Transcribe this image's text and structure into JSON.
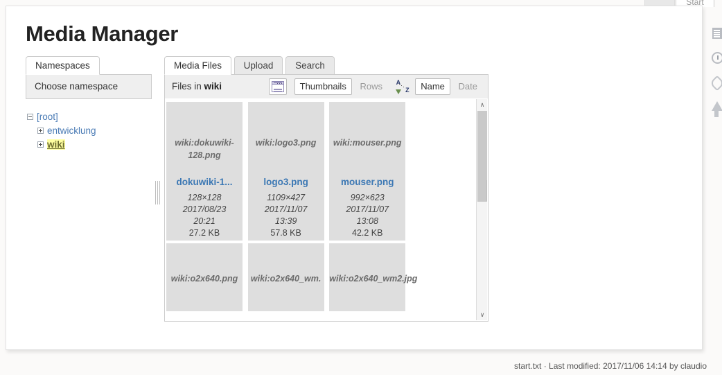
{
  "browser": {
    "start_tab_label": "Start"
  },
  "page": {
    "title": "Media Manager"
  },
  "namespace_panel": {
    "tabs": [
      {
        "label": "Namespaces",
        "active": true
      }
    ],
    "header": "Choose namespace",
    "tree": [
      {
        "label": "[root]",
        "toggle": "minus",
        "level": 1,
        "highlighted": false
      },
      {
        "label": "entwicklung",
        "toggle": "plus",
        "level": 2,
        "highlighted": false
      },
      {
        "label": "wiki",
        "toggle": "plus",
        "level": 2,
        "highlighted": true
      }
    ]
  },
  "files_panel": {
    "tabs": [
      {
        "label": "Media Files",
        "active": true
      },
      {
        "label": "Upload",
        "active": false
      },
      {
        "label": "Search",
        "active": false
      }
    ],
    "header_prefix": "Files in",
    "header_namespace": "wiki",
    "toolbar": {
      "view_icon": "window-list-icon",
      "view_options": [
        {
          "label": "Thumbnails",
          "active": true
        },
        {
          "label": "Rows",
          "active": false
        }
      ],
      "sort_icon": "sort-a-z-icon",
      "sort_icon_letters": {
        "top": "A",
        "bottom": "Z"
      },
      "sort_options": [
        {
          "label": "Name",
          "active": true
        },
        {
          "label": "Date",
          "active": false
        }
      ]
    },
    "files": [
      {
        "alt": "wiki:dokuwiki-128.png",
        "name": "dokuwiki-1...",
        "dimensions": "128×128",
        "date": "2017/08/23",
        "time": "20:21",
        "size": "27.2 KB",
        "has_meta": true
      },
      {
        "alt": "wiki:logo3.png",
        "name": "logo3.png",
        "dimensions": "1109×427",
        "date": "2017/11/07",
        "time": "13:39",
        "size": "57.8 KB",
        "has_meta": true
      },
      {
        "alt": "wiki:mouser.png",
        "name": "mouser.png",
        "dimensions": "992×623",
        "date": "2017/11/07",
        "time": "13:08",
        "size": "42.2 KB",
        "has_meta": true
      },
      {
        "alt": "wiki:o2x640.png",
        "has_meta": false
      },
      {
        "alt": "wiki:o2x640_wm.",
        "has_meta": false
      },
      {
        "alt": "wiki:o2x640_wm2.jpg",
        "has_meta": false
      }
    ],
    "scrollbar": {
      "up_arrow": "∧",
      "down_arrow": "∨"
    }
  },
  "edge_tools": [
    {
      "icon": "index-document-icon"
    },
    {
      "icon": "clock-recent-changes-icon"
    },
    {
      "icon": "paperclip-backlinks-icon"
    },
    {
      "icon": "arrow-up-back-to-top-icon"
    }
  ],
  "footer": {
    "text": "start.txt · Last modified: 2017/11/06 14:14 by claudio"
  }
}
